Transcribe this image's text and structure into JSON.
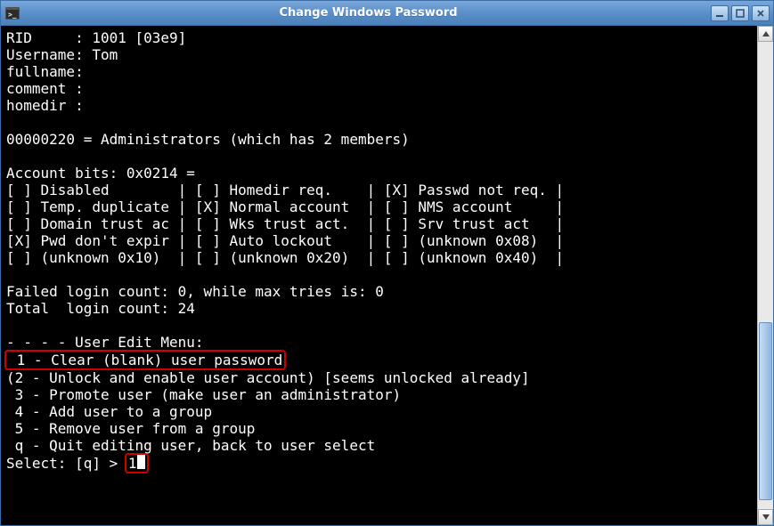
{
  "window": {
    "title": "Change Windows Password"
  },
  "user_info": {
    "rid_label": "RID     :",
    "rid_value": " 1001 [03e9]",
    "username_label": "Username:",
    "username_value": " Tom",
    "fullname_label": "fullname:",
    "fullname_value": "",
    "comment_label": "comment :",
    "comment_value": "",
    "homedir_label": "homedir :",
    "homedir_value": ""
  },
  "group_line": "00000220 = Administrators (which has 2 members)",
  "account_bits": {
    "header": "Account bits: 0x0214 =",
    "rows": [
      "[ ] Disabled        | [ ] Homedir req.    | [X] Passwd not req. |",
      "[ ] Temp. duplicate | [X] Normal account  | [ ] NMS account     |",
      "[ ] Domain trust ac | [ ] Wks trust act.  | [ ] Srv trust act   |",
      "[X] Pwd don't expir | [ ] Auto lockout    | [ ] (unknown 0x08)  |",
      "[ ] (unknown 0x10)  | [ ] (unknown 0x20)  | [ ] (unknown 0x40)  |"
    ]
  },
  "login_stats": {
    "failed": "Failed login count: 0, while max tries is: 0",
    "total": "Total  login count: 24"
  },
  "menu": {
    "header": "- - - - User Edit Menu:",
    "item1": " 1 - Clear (blank) user password",
    "item2": "(2 - Unlock and enable user account) [seems unlocked already]",
    "item3": " 3 - Promote user (make user an administrator)",
    "item4": " 4 - Add user to a group",
    "item5": " 5 - Remove user from a group",
    "itemq": " q - Quit editing user, back to user select"
  },
  "prompt": {
    "label": "Select: [q] > ",
    "input": "1"
  }
}
